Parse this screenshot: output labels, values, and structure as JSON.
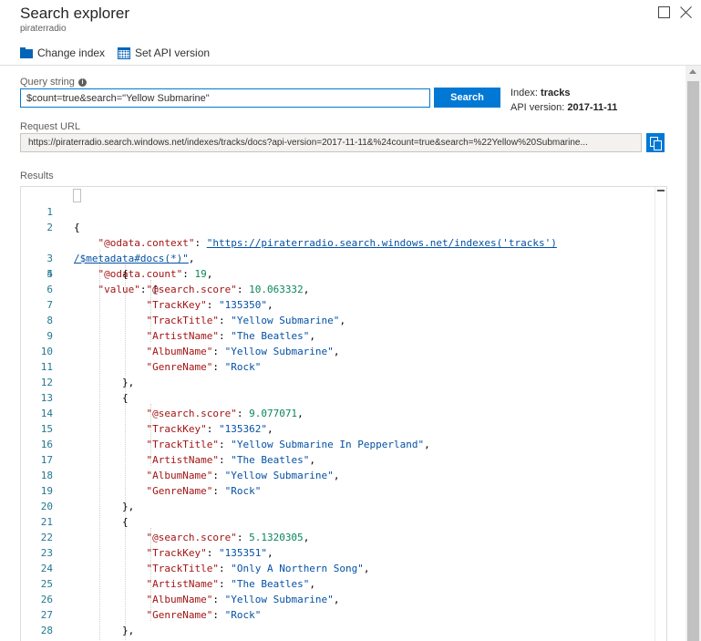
{
  "header": {
    "title": "Search explorer",
    "subtitle": "piraterradio"
  },
  "toolbar": {
    "change_index": "Change index",
    "set_api_version": "Set API version"
  },
  "query": {
    "label": "Query string",
    "value": "$count=true&search=\"Yellow Submarine\"",
    "search_button": "Search"
  },
  "index_info": {
    "index_label": "Index:",
    "index_value": "tracks",
    "api_label": "API version:",
    "api_value": "2017-11-11"
  },
  "request_url": {
    "label": "Request URL",
    "value": "https://piraterradio.search.windows.net/indexes/tracks/docs?api-version=2017-11-11&%24count=true&search=%22Yellow%20Submarine..."
  },
  "results": {
    "label": "Results",
    "line_numbers": [
      "1",
      "2",
      "",
      "3",
      "4",
      "5",
      "6",
      "7",
      "8",
      "9",
      "10",
      "11",
      "12",
      "13",
      "14",
      "15",
      "16",
      "17",
      "18",
      "19",
      "20",
      "21",
      "22",
      "23",
      "24",
      "25",
      "26",
      "27",
      "28"
    ],
    "json": {
      "open": "{",
      "context_key": "\"@odata.context\"",
      "context_value": "\"https://piraterradio.search.windows.net/indexes('tracks')",
      "context_value_cont": "/$metadata#docs(*)\"",
      "count_key": "\"@odata.count\"",
      "count_value": "19",
      "value_key": "\"value\"",
      "docs": [
        {
          "score": "10.063332",
          "TrackKey": "\"135350\"",
          "TrackTitle": "\"Yellow Submarine\"",
          "ArtistName": "\"The Beatles\"",
          "AlbumName": "\"Yellow Submarine\"",
          "GenreName": "\"Rock\""
        },
        {
          "score": "9.077071",
          "TrackKey": "\"135362\"",
          "TrackTitle": "\"Yellow Submarine In Pepperland\"",
          "ArtistName": "\"The Beatles\"",
          "AlbumName": "\"Yellow Submarine\"",
          "GenreName": "\"Rock\""
        },
        {
          "score": "5.1320305",
          "TrackKey": "\"135351\"",
          "TrackTitle": "\"Only A Northern Song\"",
          "ArtistName": "\"The Beatles\"",
          "AlbumName": "\"Yellow Submarine\"",
          "GenreName": "\"Rock\""
        }
      ]
    }
  }
}
